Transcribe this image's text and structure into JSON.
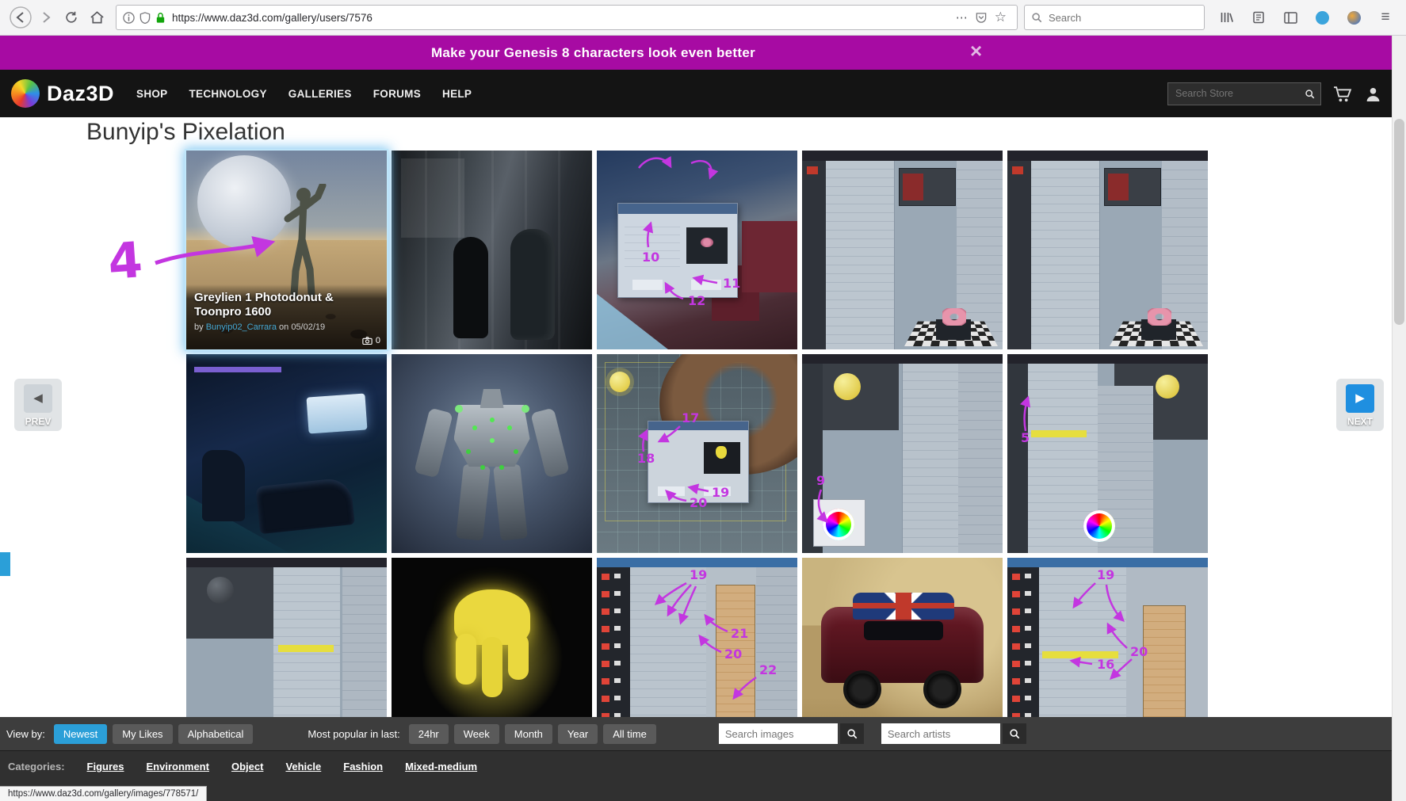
{
  "browser": {
    "url": "https://www.daz3d.com/gallery/users/7576",
    "search_placeholder": "Search"
  },
  "icons": {
    "close_banner": "×",
    "overflow_menu": "⋯",
    "bookmark_star": "☆",
    "app_menu": "≡",
    "prev_arrow": "◀",
    "next_arrow": "▶"
  },
  "banner": {
    "message": "Make your Genesis 8 characters look even better"
  },
  "nav": {
    "brand": "Daz3D",
    "items": [
      {
        "label": "SHOP"
      },
      {
        "label": "TECHNOLOGY"
      },
      {
        "label": "GALLERIES"
      },
      {
        "label": "FORUMS"
      },
      {
        "label": "HELP"
      }
    ],
    "store_search_placeholder": "Search Store"
  },
  "page": {
    "title": "Bunyip's Pixelation"
  },
  "pager": {
    "prev": "PREV",
    "next": "NEXT"
  },
  "featured": {
    "title": "Greylien 1 Photodonut & Toonpro 1600",
    "by": "by",
    "author": "Bunyip02_Carrara",
    "date": "on 05/02/19",
    "count": "0"
  },
  "annotations": {
    "main": "4",
    "t3": [
      "10",
      "11",
      "12"
    ],
    "t8": [
      "17",
      "18",
      "19",
      "20"
    ],
    "t9": [
      "9"
    ],
    "t10": [
      "5"
    ],
    "t13": [
      "19",
      "21",
      "20",
      "22"
    ],
    "t15": [
      "19",
      "20",
      "16"
    ]
  },
  "toolbar": {
    "view_by_label": "View by:",
    "view_options": [
      {
        "label": "Newest"
      },
      {
        "label": "My Likes"
      },
      {
        "label": "Alphabetical"
      }
    ],
    "popular_label": "Most popular in last:",
    "popular_options": [
      {
        "label": "24hr"
      },
      {
        "label": "Week"
      },
      {
        "label": "Month"
      },
      {
        "label": "Year"
      },
      {
        "label": "All time"
      }
    ],
    "search_images_placeholder": "Search images",
    "search_artists_placeholder": "Search artists"
  },
  "footer": {
    "categories_label": "Categories:",
    "categories": [
      {
        "label": "Figures"
      },
      {
        "label": "Environment"
      },
      {
        "label": "Object"
      },
      {
        "label": "Vehicle"
      },
      {
        "label": "Fashion"
      },
      {
        "label": "Mixed-medium"
      }
    ]
  },
  "statusbar": {
    "link": "https://www.daz3d.com/gallery/images/778571/"
  }
}
